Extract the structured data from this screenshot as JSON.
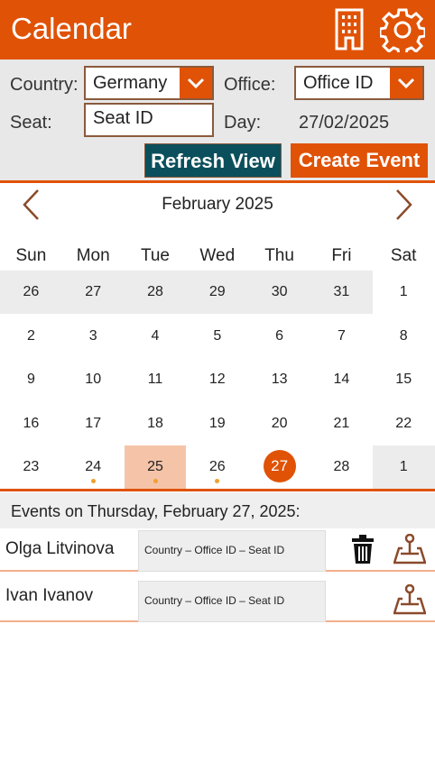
{
  "header": {
    "title": "Calendar"
  },
  "form": {
    "country_label": "Country:",
    "country_value": "Germany",
    "office_label": "Office:",
    "office_value": "Office ID",
    "seat_label": "Seat:",
    "seat_value": "Seat ID",
    "day_label": "Day:",
    "day_value": "27/02/2025",
    "refresh_label": "Refresh View",
    "create_label": "Create Event"
  },
  "colors": {
    "accent": "#e05206",
    "teal": "#0b4f5c",
    "selected": "#f5c4a8"
  },
  "calendar": {
    "month": "February 2025",
    "weekdays": [
      "Sun",
      "Mon",
      "Tue",
      "Wed",
      "Thu",
      "Fri",
      "Sat"
    ],
    "weeks": [
      [
        "26",
        "27",
        "28",
        "29",
        "30",
        "31",
        "1"
      ],
      [
        "2",
        "3",
        "4",
        "5",
        "6",
        "7",
        "8"
      ],
      [
        "9",
        "10",
        "11",
        "12",
        "13",
        "14",
        "15"
      ],
      [
        "16",
        "17",
        "18",
        "19",
        "20",
        "21",
        "22"
      ],
      [
        "23",
        "24",
        "25",
        "26",
        "27",
        "28",
        "1"
      ]
    ],
    "other_month": [
      [
        0,
        0
      ],
      [
        0,
        1
      ],
      [
        0,
        2
      ],
      [
        0,
        3
      ],
      [
        0,
        4
      ],
      [
        0,
        5
      ],
      [
        4,
        6
      ]
    ],
    "today": [
      4,
      4
    ],
    "selected": [
      4,
      2
    ],
    "has_events": [
      [
        4,
        1
      ],
      [
        4,
        2
      ],
      [
        4,
        3
      ]
    ]
  },
  "events": {
    "heading": "Events on Thursday, February 27, 2025:",
    "items": [
      {
        "name": "Olga Litvinova",
        "location": "Country – Office ID – Seat ID",
        "can_delete": true
      },
      {
        "name": "Ivan Ivanov",
        "location": "Country – Office ID – Seat ID",
        "can_delete": false
      }
    ]
  }
}
